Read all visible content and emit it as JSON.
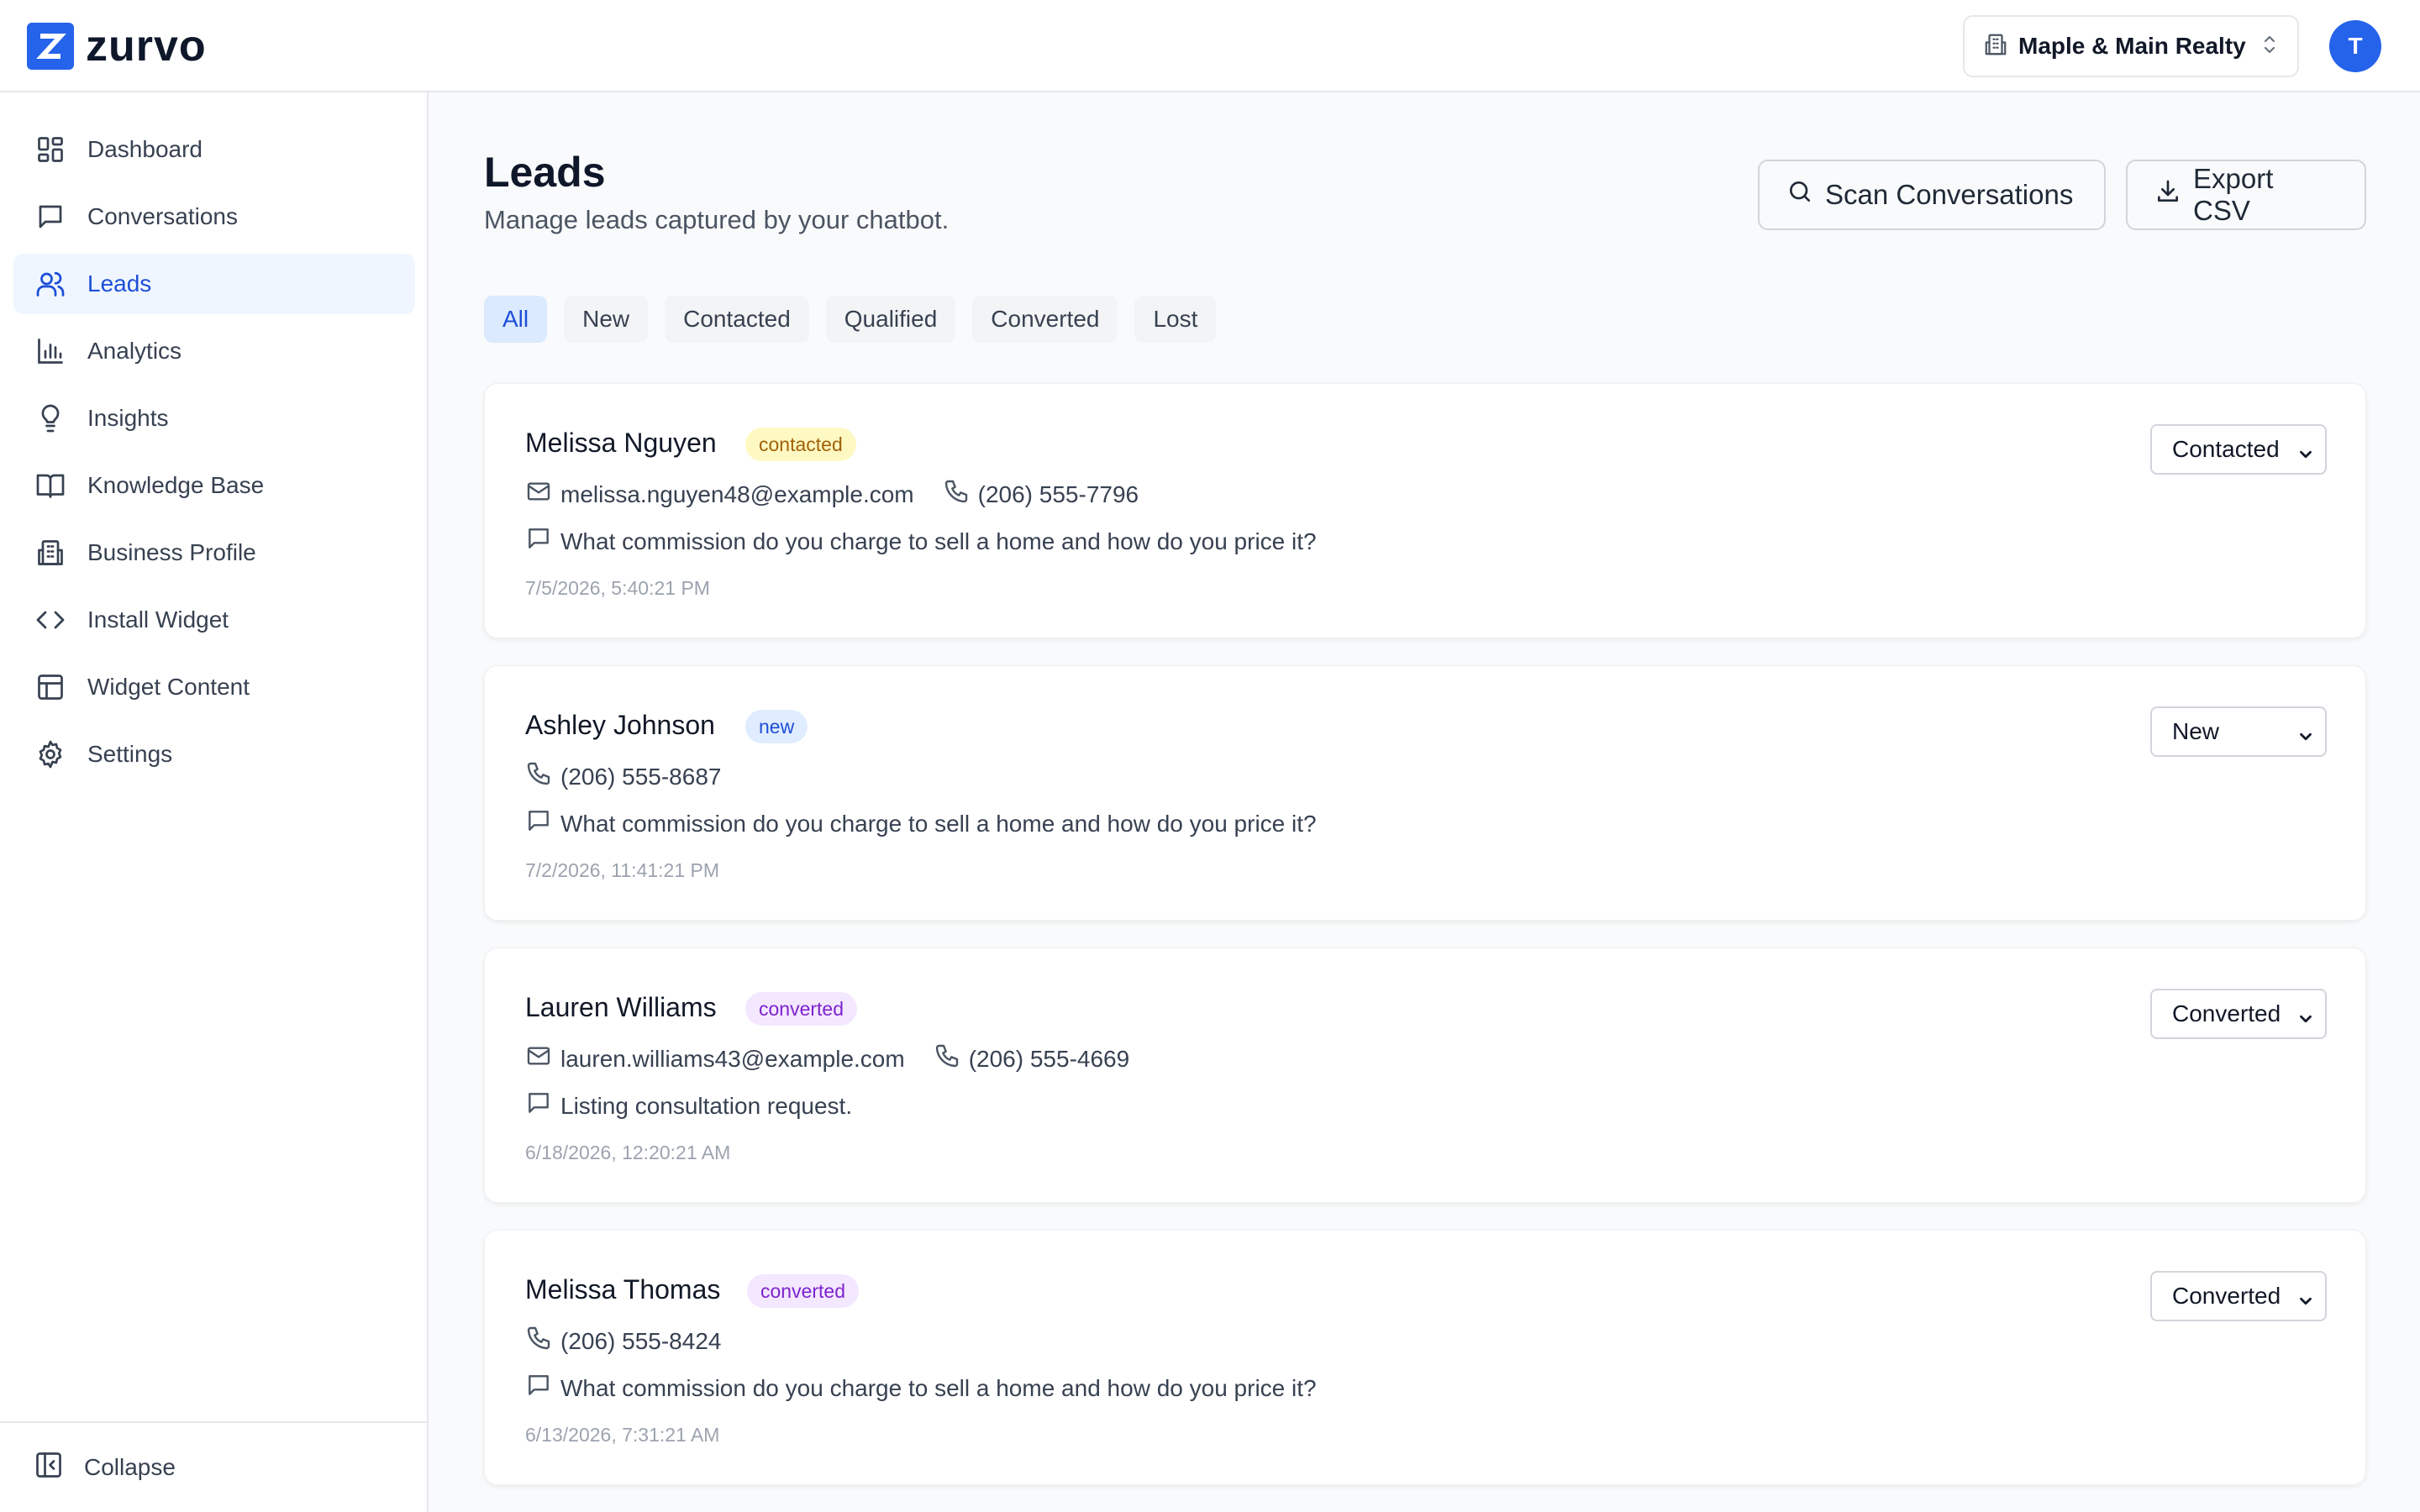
{
  "app": {
    "logo_letter": "Z",
    "name": "zurvo",
    "brand_color": "#2563eb"
  },
  "business_switcher": {
    "name": "Maple & Main Realty"
  },
  "user": {
    "avatar_initial": "T"
  },
  "sidebar": {
    "items": [
      {
        "label": "Dashboard",
        "icon": "dashboard-icon",
        "active": false
      },
      {
        "label": "Conversations",
        "icon": "message-square-icon",
        "active": false
      },
      {
        "label": "Leads",
        "icon": "users-icon",
        "active": true
      },
      {
        "label": "Analytics",
        "icon": "bar-chart-icon",
        "active": false
      },
      {
        "label": "Insights",
        "icon": "lightbulb-icon",
        "active": false
      },
      {
        "label": "Knowledge Base",
        "icon": "book-open-icon",
        "active": false
      },
      {
        "label": "Business Profile",
        "icon": "building-icon",
        "active": false
      },
      {
        "label": "Install Widget",
        "icon": "code-icon",
        "active": false
      },
      {
        "label": "Widget Content",
        "icon": "layout-icon",
        "active": false
      },
      {
        "label": "Settings",
        "icon": "gear-icon",
        "active": false
      }
    ],
    "collapse_label": "Collapse"
  },
  "page": {
    "title": "Leads",
    "subtitle": "Manage leads captured by your chatbot.",
    "scan_label": "Scan Conversations",
    "export_label": "Export CSV"
  },
  "filters": {
    "tabs": [
      "All",
      "New",
      "Contacted",
      "Qualified",
      "Converted",
      "Lost"
    ],
    "active": "All"
  },
  "leads": [
    {
      "name": "Melissa Nguyen",
      "badge": "contacted",
      "email": "melissa.nguyen48@example.com",
      "phone": "(206) 555-7796",
      "message": "What commission do you charge to sell a home and how do you price it?",
      "timestamp": "7/5/2026, 5:40:21 PM",
      "status": "Contacted"
    },
    {
      "name": "Ashley Johnson",
      "badge": "new",
      "email": "",
      "phone": "(206) 555-8687",
      "message": "What commission do you charge to sell a home and how do you price it?",
      "timestamp": "7/2/2026, 11:41:21 PM",
      "status": "New"
    },
    {
      "name": "Lauren Williams",
      "badge": "converted",
      "email": "lauren.williams43@example.com",
      "phone": "(206) 555-4669",
      "message": "Listing consultation request.",
      "timestamp": "6/18/2026, 12:20:21 AM",
      "status": "Converted"
    },
    {
      "name": "Melissa Thomas",
      "badge": "converted",
      "email": "",
      "phone": "(206) 555-8424",
      "message": "What commission do you charge to sell a home and how do you price it?",
      "timestamp": "6/13/2026, 7:31:21 AM",
      "status": "Converted"
    }
  ]
}
